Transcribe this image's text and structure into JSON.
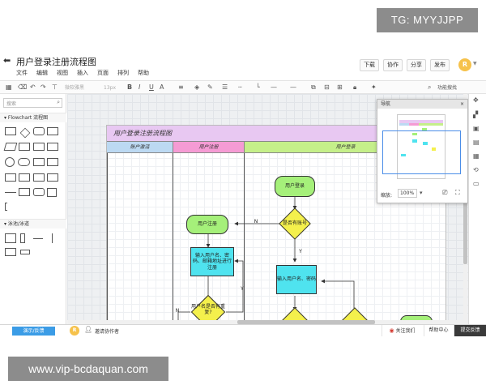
{
  "watermark_top": "TG: MYYJJPP",
  "watermark_bottom": "www.vip-bcdaquan.com",
  "header": {
    "title": "用户登录注册流程图",
    "menu": [
      "文件",
      "编辑",
      "视图",
      "插入",
      "页面",
      "排列",
      "帮助"
    ],
    "buttons": {
      "download": "下载",
      "collab": "协作",
      "share": "分享",
      "publish": "发布"
    },
    "avatar": "R"
  },
  "toolbar": {
    "font": "微软雅黑",
    "size": "13px",
    "bold": "B",
    "italic": "I",
    "underline": "U",
    "fontcolor": "A",
    "features": "功能搜找"
  },
  "sidebar": {
    "search_placeholder": "搜索",
    "section1": "Flowchart 流程图",
    "section2": "泳池/泳道"
  },
  "diagram": {
    "pool_title": "用户登录注册流程图",
    "lanes": [
      "账户激活",
      "用户注册",
      "用户登录"
    ],
    "nodes": {
      "login": "用户登录",
      "register": "用户注册",
      "has_account": "是否有账号",
      "input_register": "输入用户名、密码、邮箱地址进行注册",
      "input_login": "输入用户名、密码",
      "username_dup": "用户名是否有重复?"
    },
    "labels": {
      "n1": "N",
      "y1": "Y",
      "y2": "Y",
      "n2": "N"
    }
  },
  "navigator": {
    "title": "导航",
    "close": "×",
    "zoom_label": "缩放:",
    "zoom_value": "100%"
  },
  "footer": {
    "demo": "演示/反馈",
    "avatar": "R",
    "invite": "邀请协作者",
    "follow": "关注我们",
    "help": "帮助中心",
    "feedback": "提交反馈"
  }
}
